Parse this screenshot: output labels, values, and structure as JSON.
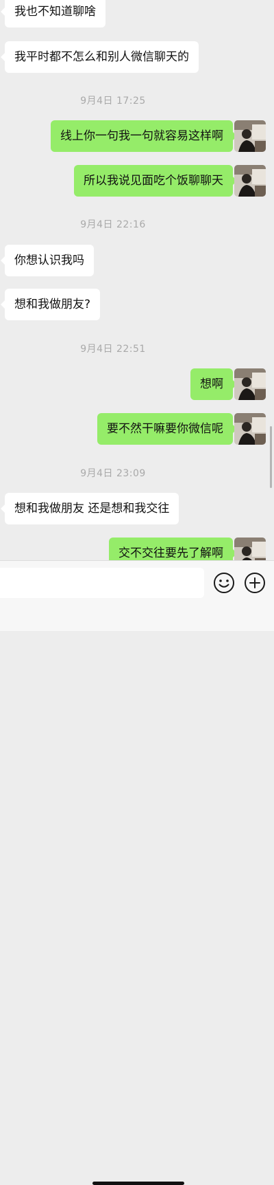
{
  "messages": [
    {
      "kind": "text",
      "dir": "in",
      "text": "我也不知道聊啥"
    },
    {
      "kind": "text",
      "dir": "in",
      "text": "我平时都不怎么和别人微信聊天的"
    },
    {
      "kind": "time",
      "text": "9月4日 17:25"
    },
    {
      "kind": "text",
      "dir": "out",
      "text": "线上你一句我一句就容易这样啊"
    },
    {
      "kind": "text",
      "dir": "out",
      "text": "所以我说见面吃个饭聊聊天"
    },
    {
      "kind": "time",
      "text": "9月4日 22:16"
    },
    {
      "kind": "text",
      "dir": "in",
      "text": "你想认识我吗"
    },
    {
      "kind": "text",
      "dir": "in",
      "text": "想和我做朋友?"
    },
    {
      "kind": "time",
      "text": "9月4日 22:51"
    },
    {
      "kind": "text",
      "dir": "out",
      "text": "想啊"
    },
    {
      "kind": "text",
      "dir": "out",
      "text": "要不然干嘛要你微信呢"
    },
    {
      "kind": "time",
      "text": "9月4日 23:09"
    },
    {
      "kind": "text",
      "dir": "in",
      "text": "想和我做朋友 还是想和我交往"
    },
    {
      "kind": "text",
      "dir": "out",
      "text": "交不交往要先了解啊"
    }
  ],
  "input": {
    "value": "",
    "placeholder": ""
  },
  "icons": {
    "emoji": "emoji-icon",
    "more": "plus-icon"
  },
  "colors": {
    "background": "#ededed",
    "outgoing_bubble": "#95ec69",
    "incoming_bubble": "#ffffff",
    "timestamp": "#a9a9a9"
  }
}
